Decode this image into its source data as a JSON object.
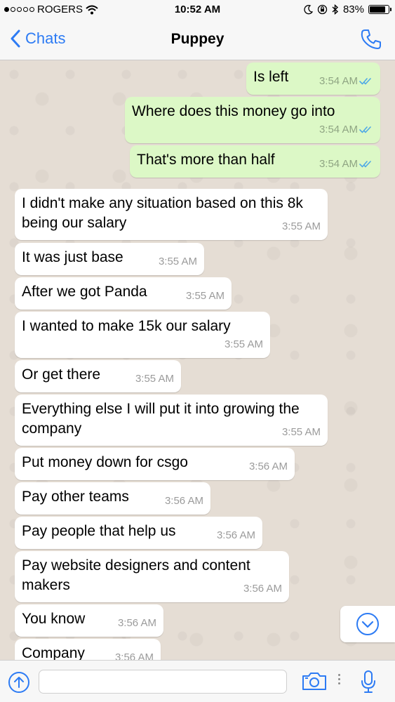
{
  "status_bar": {
    "carrier": "ROGERS",
    "time": "10:52 AM",
    "battery": "83%",
    "battery_level": 0.83
  },
  "nav": {
    "back_label": "Chats",
    "title": "Puppey"
  },
  "messages": [
    {
      "dir": "out",
      "text": "Is left",
      "time": "3:54 AM"
    },
    {
      "dir": "out",
      "text": "Where does this money go into",
      "time": "3:54 AM"
    },
    {
      "dir": "out",
      "text": "That's more than half",
      "time": "3:54 AM"
    },
    {
      "dir": "in",
      "text": "I didn't make any situation based on this 8k being our salary",
      "time": "3:55 AM"
    },
    {
      "dir": "in",
      "text": "It was just base",
      "time": "3:55 AM"
    },
    {
      "dir": "in",
      "text": "After we got Panda",
      "time": "3:55 AM"
    },
    {
      "dir": "in",
      "text": "I wanted to make 15k our salary",
      "time": "3:55 AM"
    },
    {
      "dir": "in",
      "text": "Or get there",
      "time": "3:55 AM"
    },
    {
      "dir": "in",
      "text": "Everything else I will put it into growing the company",
      "time": "3:55 AM"
    },
    {
      "dir": "in",
      "text": "Put money down for csgo",
      "time": "3:56 AM"
    },
    {
      "dir": "in",
      "text": "Pay other teams",
      "time": "3:56 AM"
    },
    {
      "dir": "in",
      "text": "Pay people that help us",
      "time": "3:56 AM"
    },
    {
      "dir": "in",
      "text": "Pay website designers and content makers",
      "time": "3:56 AM"
    },
    {
      "dir": "in",
      "text": "You know",
      "time": "3:56 AM"
    },
    {
      "dir": "in",
      "text": "Company",
      "time": "3:56 AM"
    }
  ],
  "input": {
    "value": "",
    "placeholder": ""
  },
  "icons": {
    "back": "chevron-left-icon",
    "call": "phone-icon",
    "scroll": "chevron-down-circle-icon",
    "share": "arrow-up-circle-icon",
    "camera": "camera-icon",
    "more": "vertical-dots-icon",
    "mic": "microphone-icon"
  },
  "colors": {
    "accent": "#2d7bf4",
    "outgoing_bubble": "#dcf8c6",
    "incoming_bubble": "#ffffff",
    "read_ticks": "#4fa9e6",
    "chat_background": "#e5ddd4"
  }
}
